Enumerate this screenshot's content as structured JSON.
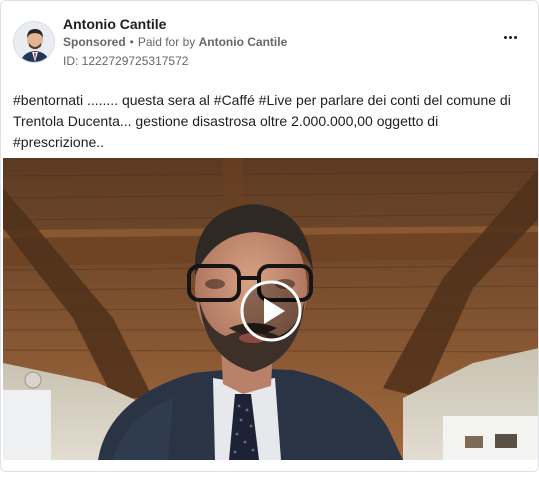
{
  "post": {
    "author_name": "Antonio Cantile",
    "sponsored_label": "Sponsored",
    "separator": "•",
    "paid_for_prefix": "Paid for by",
    "paid_for_name": "Antonio Cantile",
    "ad_id": "ID: 1222729725317572",
    "text": "#bentornati ........ questa sera al #Caffé #Live per parlare dei conti del comune di Trentola Ducenta... gestione disastrosa oltre 2.000.000,00 oggetto di #prescrizione.."
  },
  "icons": {
    "more": "more-options-icon",
    "play": "play-icon",
    "avatar": "profile-photo"
  },
  "colors": {
    "text_primary": "#1c1e21",
    "text_secondary": "#65676b",
    "border": "#dfe1e5"
  }
}
